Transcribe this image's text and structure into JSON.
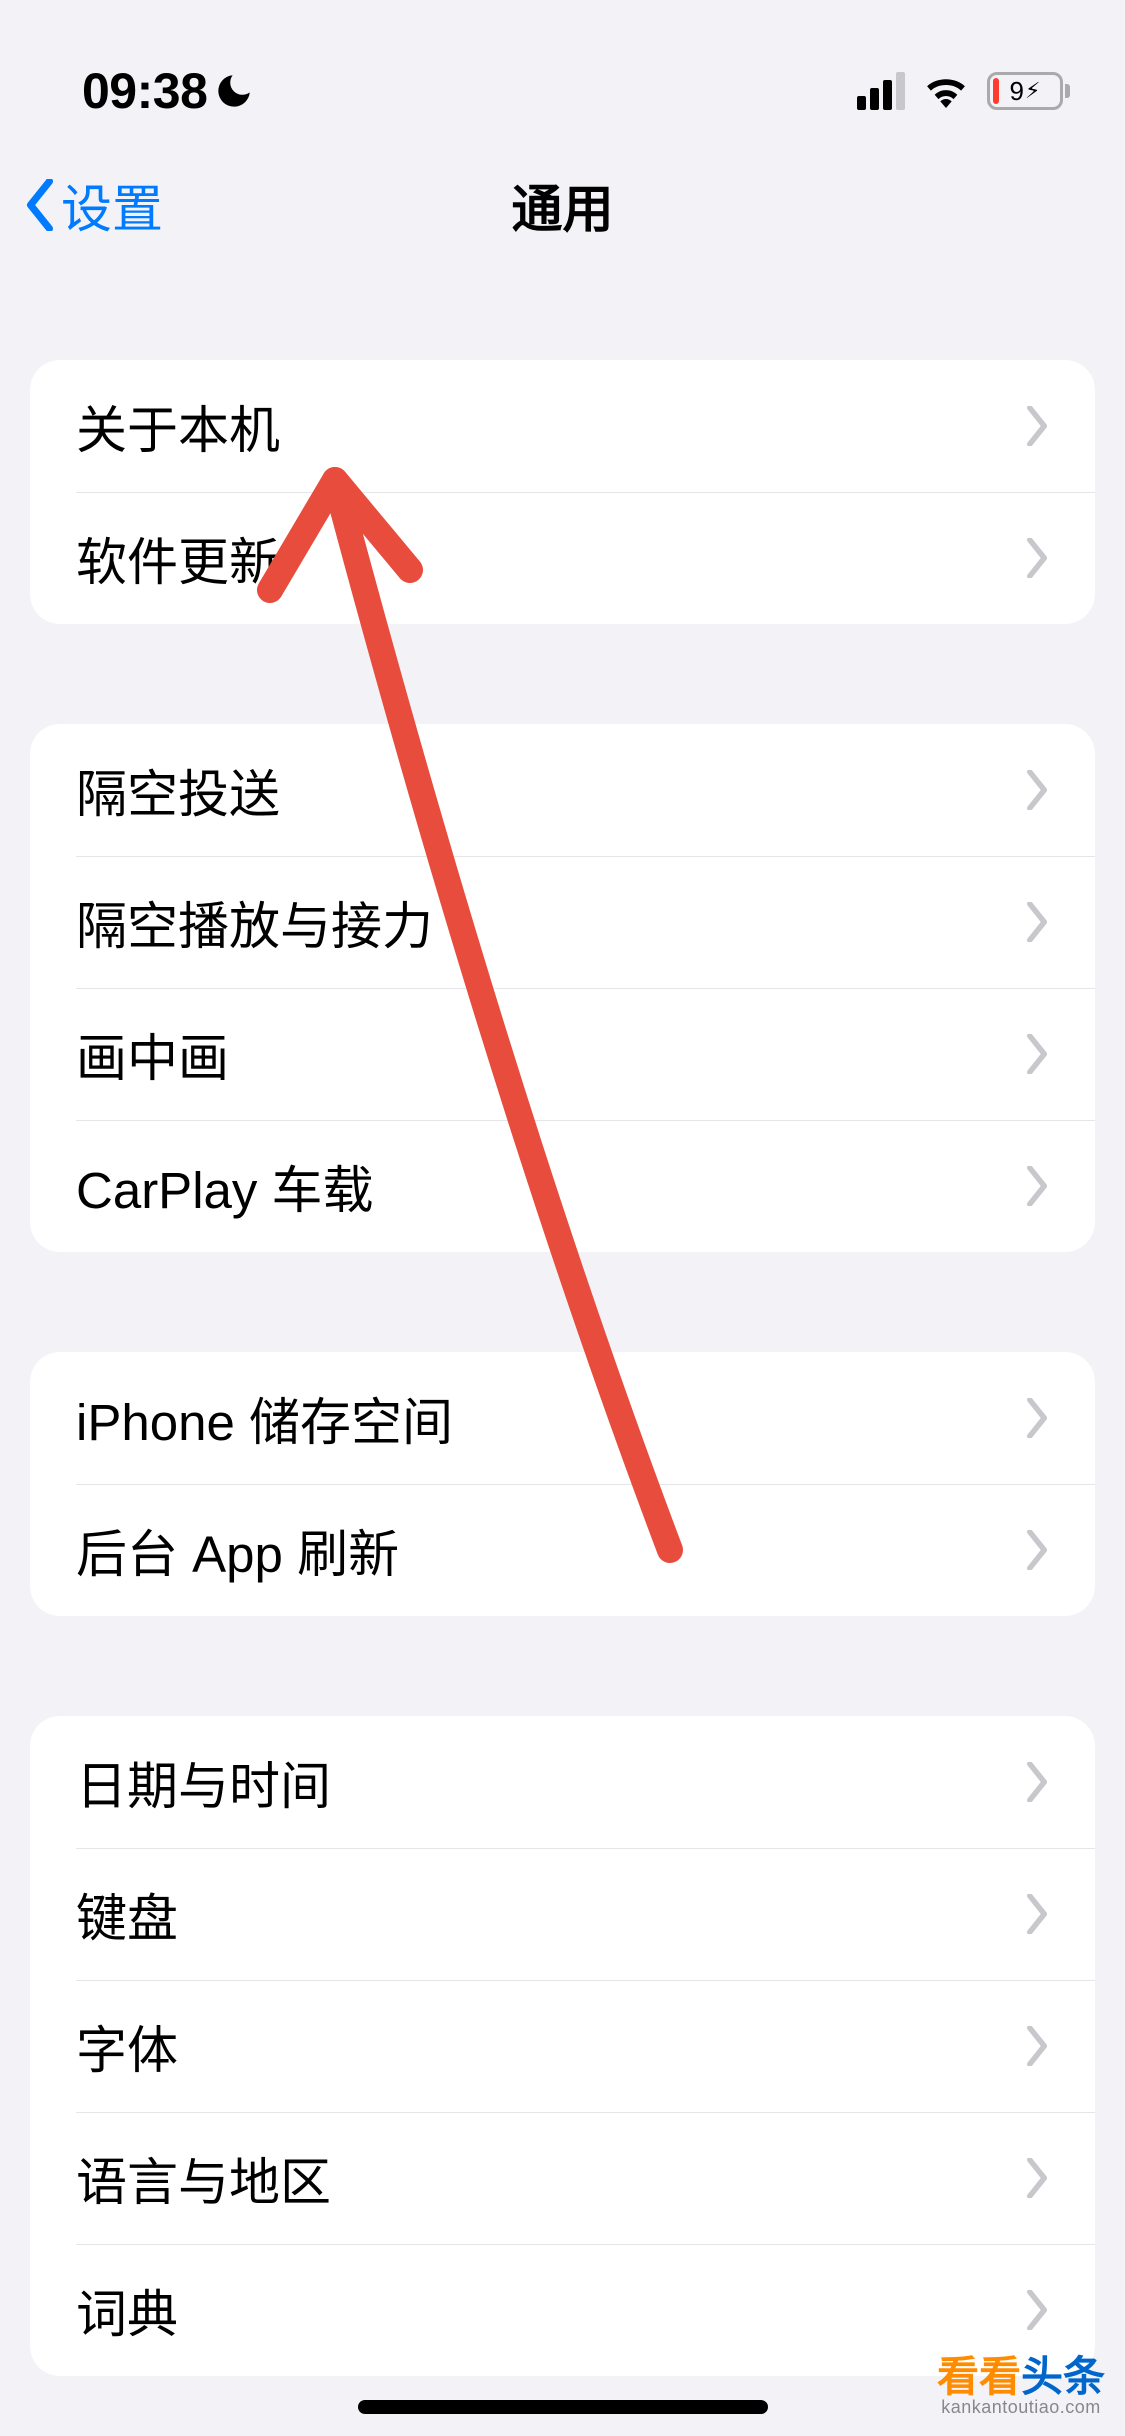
{
  "status": {
    "time": "09:38",
    "battery_text": "9"
  },
  "nav": {
    "back_label": "设置",
    "title": "通用"
  },
  "groups": [
    {
      "rows": [
        {
          "label": "关于本机"
        },
        {
          "label": "软件更新"
        }
      ]
    },
    {
      "rows": [
        {
          "label": "隔空投送"
        },
        {
          "label": "隔空播放与接力"
        },
        {
          "label": "画中画"
        },
        {
          "label": "CarPlay 车载"
        }
      ]
    },
    {
      "rows": [
        {
          "label": "iPhone 储存空间"
        },
        {
          "label": "后台 App 刷新"
        }
      ]
    },
    {
      "rows": [
        {
          "label": "日期与时间"
        },
        {
          "label": "键盘"
        },
        {
          "label": "字体"
        },
        {
          "label": "语言与地区"
        },
        {
          "label": "词典"
        }
      ]
    }
  ],
  "watermark": {
    "main_part1": "看看",
    "main_part2": "头条",
    "sub": "kankantoutiao.com"
  }
}
